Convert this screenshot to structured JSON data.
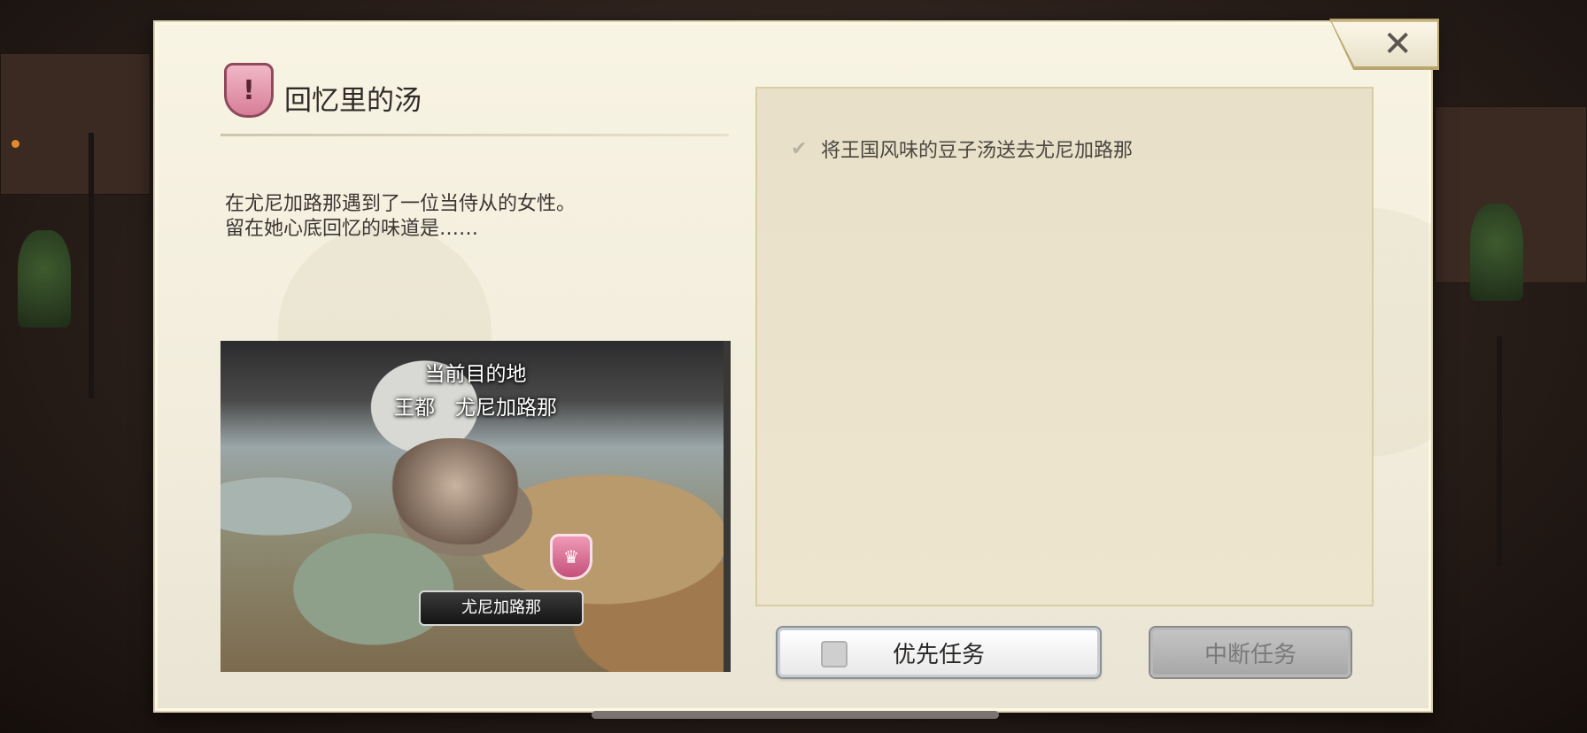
{
  "quest": {
    "title": "回忆里的汤",
    "description_line1": "在尤尼加路那遇到了一位当侍从的女性。",
    "description_line2": "留在她心底回忆的味道是……",
    "icon": "exclamation-shield-icon"
  },
  "map": {
    "heading": "当前目的地",
    "destination": "王都　尤尼加路那",
    "marker_label": "尤尼加路那",
    "marker_icon": "crown-shield-icon"
  },
  "objectives": [
    {
      "text": "将王国风味的豆子汤送去尤尼加路那",
      "completed": false
    }
  ],
  "buttons": {
    "priority_label": "优先任务",
    "abort_label": "中断任务",
    "close_glyph": "✕"
  },
  "colors": {
    "dialog_bg": "#f1ecdb",
    "panel_bg": "#e8e0c8",
    "quest_icon": "#d67e98",
    "disabled_button": "#a8a8a8"
  }
}
